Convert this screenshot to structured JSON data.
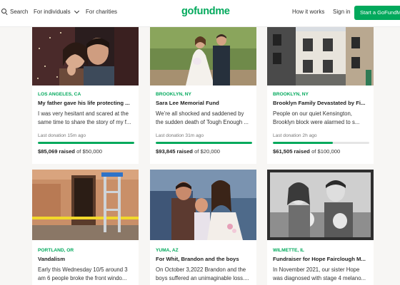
{
  "header": {
    "search_label": "Search",
    "for_individuals_label": "For individuals",
    "for_charities_label": "For charities",
    "logo_text": "gofundme",
    "how_it_works_label": "How it works",
    "sign_in_label": "Sign in",
    "start_button_label": "Start a GoFundMe"
  },
  "colors": {
    "brand_green": "#02a95c"
  },
  "cards": [
    {
      "location": "LOS ANGELES, CA",
      "title": "My father gave his life protecting ...",
      "description": "I was very hesitant and scared at the same time to share the story of my f...",
      "last_donation": "Last donation 15m ago",
      "raised_amount": "$85,069 raised",
      "goal_text": "of $50,000",
      "progress_fraction": 1.0
    },
    {
      "location": "BROOKLYN, NY",
      "title": "Sara Lee Memorial Fund",
      "description": "We’re all shocked and saddened by the sudden death of Tough Enough ...",
      "last_donation": "Last donation 31m ago",
      "raised_amount": "$93,845 raised",
      "goal_text": "of $20,000",
      "progress_fraction": 1.0
    },
    {
      "location": "BROOKLYN, NY",
      "title": "Brooklyn Family Devastated by Fi...",
      "description": "People on our quiet Kensington, Brooklyn block were alarmed to s...",
      "last_donation": "Last donation 2h ago",
      "raised_amount": "$61,505 raised",
      "goal_text": "of $100,000",
      "progress_fraction": 0.62
    },
    {
      "location": "PORTLAND, OR",
      "title": "Vandalism",
      "description": "Early this Wednesday 10/5 around 3 am 6 people broke the front windo...",
      "last_donation": "",
      "raised_amount": "",
      "goal_text": ""
    },
    {
      "location": "YUMA, AZ",
      "title": "For Whit, Brandon and the boys",
      "description": "On October 3,2022 Brandon and the boys suffered an unimaginable loss....",
      "last_donation": "",
      "raised_amount": "",
      "goal_text": ""
    },
    {
      "location": "WILMETTE, IL",
      "title": "Fundraiser for Hope Fairclough M...",
      "description": "In November 2021, our sister Hope was diagnosed with stage 4 melano...",
      "last_donation": "",
      "raised_amount": "",
      "goal_text": ""
    }
  ]
}
